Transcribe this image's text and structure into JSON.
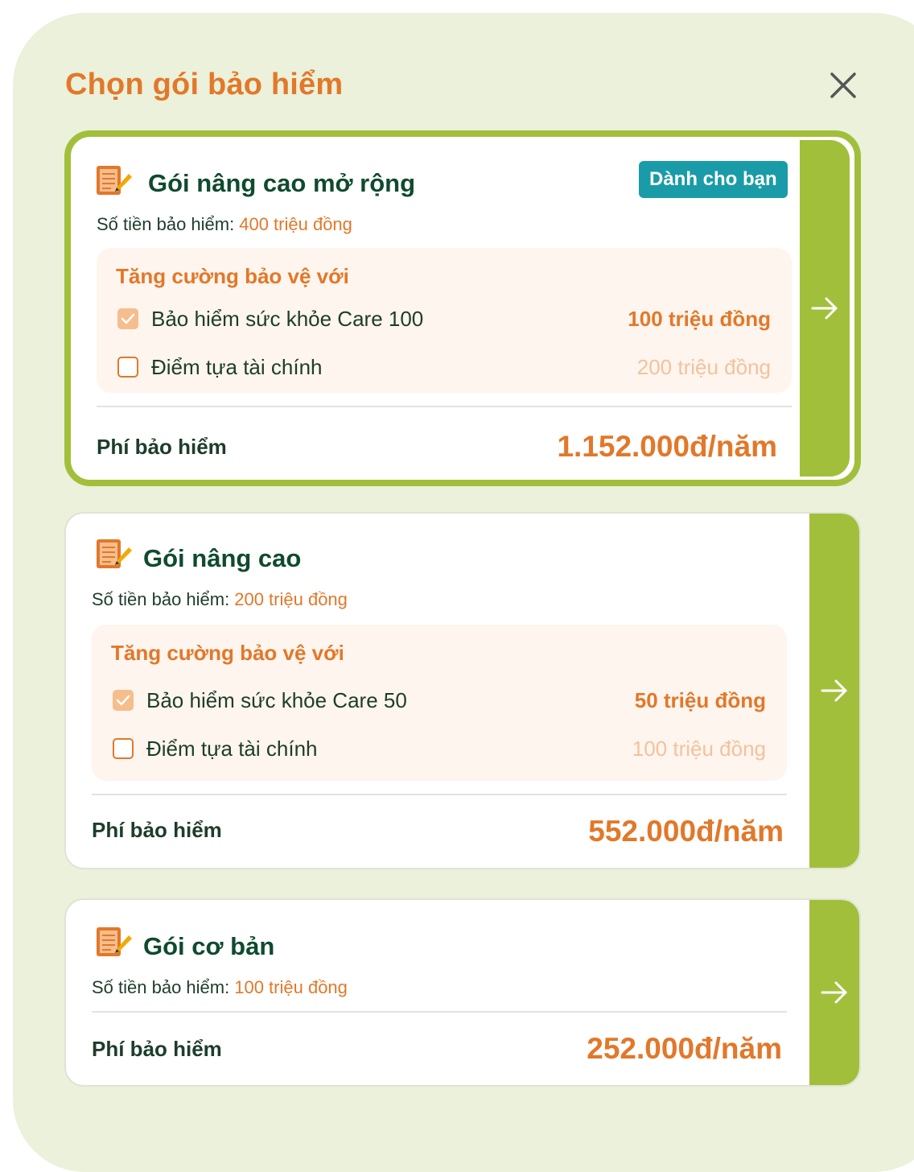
{
  "modal": {
    "title": "Chọn gói bảo hiểm",
    "close_icon": "close-icon"
  },
  "colors": {
    "accent_orange": "#e2782a",
    "accent_green": "#a2bf3b",
    "badge_teal": "#1a9ba8",
    "text_dark_green": "#0f4b2e",
    "panel_bg": "#ebf1da"
  },
  "plans": [
    {
      "name": "Gói nâng cao mở rộng",
      "badge": "Dành cho bạn",
      "selected": true,
      "sum_label": "Số tiền bảo hiểm:",
      "sum_value": "400 triệu đồng",
      "addons_title": "Tăng cường bảo vệ với",
      "addons": [
        {
          "name": "Bảo hiểm sức khỏe Care 100",
          "value": "100 triệu đồng",
          "checked": true
        },
        {
          "name": "Điểm tựa tài chính",
          "value": "200 triệu đồng",
          "checked": false
        }
      ],
      "fee_label": "Phí bảo hiểm",
      "fee_value": "1.152.000đ/năm"
    },
    {
      "name": "Gói nâng cao",
      "selected": false,
      "sum_label": "Số tiền bảo hiểm:",
      "sum_value": "200 triệu đồng",
      "addons_title": "Tăng cường bảo vệ với",
      "addons": [
        {
          "name": "Bảo hiểm sức khỏe Care 50",
          "value": "50 triệu đồng",
          "checked": true
        },
        {
          "name": "Điểm tựa tài chính",
          "value": "100 triệu đồng",
          "checked": false
        }
      ],
      "fee_label": "Phí bảo hiểm",
      "fee_value": "552.000đ/năm"
    },
    {
      "name": "Gói cơ bản",
      "selected": false,
      "sum_label": "Số tiền bảo hiểm:",
      "sum_value": "100 triệu đồng",
      "fee_label": "Phí bảo hiểm",
      "fee_value": "252.000đ/năm"
    }
  ]
}
